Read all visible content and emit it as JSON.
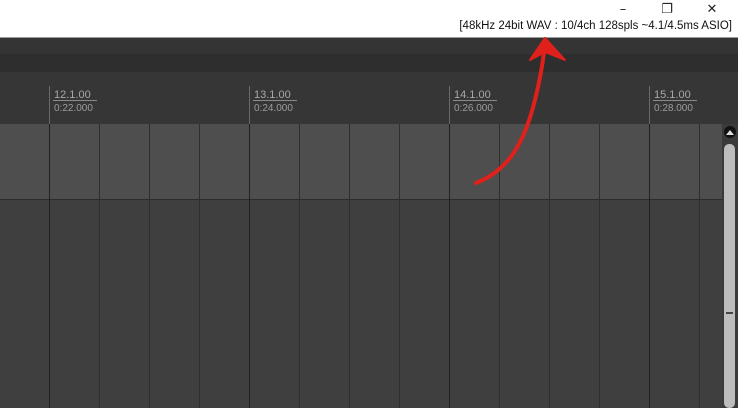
{
  "window": {
    "minimize_glyph": "–",
    "maximize_glyph": "❐",
    "close_glyph": "✕"
  },
  "status": {
    "text": "[48kHz 24bit WAV : 10/4ch 128spls ~4.1/4.5ms ASIO]"
  },
  "ruler": {
    "markers": [
      {
        "beat": "12.1.00",
        "time": "0:22.000"
      },
      {
        "beat": "13.1.00",
        "time": "0:24.000"
      },
      {
        "beat": "14.1.00",
        "time": "0:26.000"
      },
      {
        "beat": "15.1.00",
        "time": "0:28.000"
      }
    ]
  },
  "annotation": {
    "color": "#e0201a",
    "icon": "red-arrow-annotation"
  }
}
